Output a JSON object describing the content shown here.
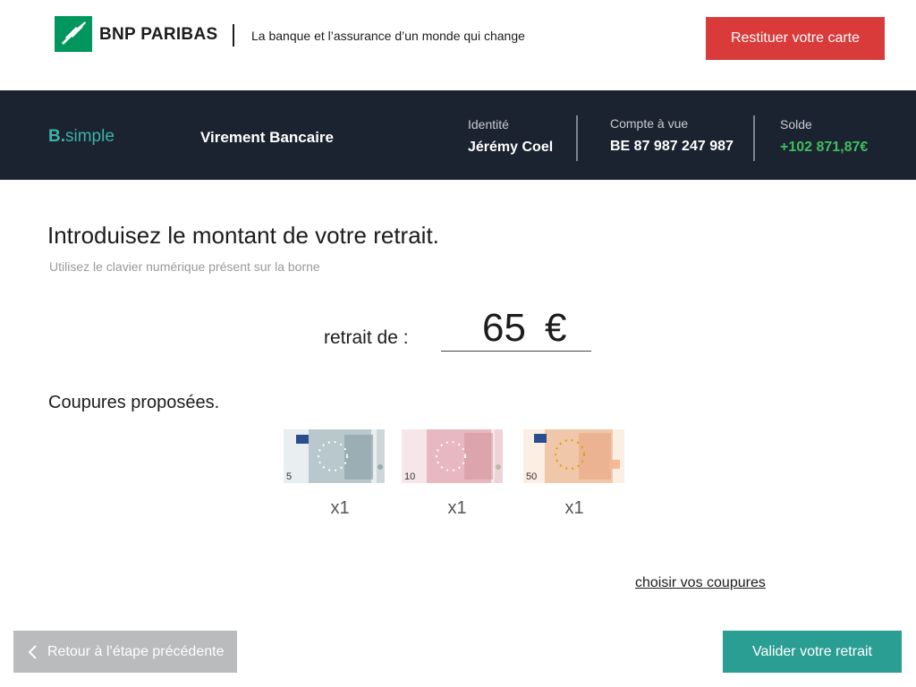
{
  "header": {
    "brand": "BNP PARIBAS",
    "tagline": "La banque et l’assurance d’un monde qui change",
    "return_card_label": "Restituer votre carte"
  },
  "infobar": {
    "app_name_b": "B.",
    "app_name_rest": "simple",
    "operation": "Virement Bancaire",
    "identity_label": "Identité",
    "identity_value": "Jérémy Coel",
    "account_label": "Compte à vue",
    "account_value": "BE 87 987 247 987",
    "balance_label": "Solde",
    "balance_value": "+102 871,87€"
  },
  "main": {
    "title": "Introduisez le montant de votre retrait.",
    "subtitle": "Utilisez le clavier numérique présent sur la borne",
    "withdraw_label": "retrait de :",
    "amount": "65",
    "currency": "€",
    "denominations_title": "Coupures proposées.",
    "notes": [
      {
        "value": "5",
        "count": "x1",
        "color": "#b9c8cc"
      },
      {
        "value": "10",
        "count": "x1",
        "color": "#e8b8c0"
      },
      {
        "value": "50",
        "count": "x1",
        "color": "#f0c7a8"
      }
    ],
    "choose_link": "choisir vos coupures"
  },
  "footer": {
    "back_label": "Retour à l’étape précédente",
    "validate_label": "Valider votre retrait"
  },
  "colors": {
    "red": "#d93a3a",
    "teal": "#2b9e93",
    "dark": "#1b2330",
    "green": "#3fbf5f"
  }
}
